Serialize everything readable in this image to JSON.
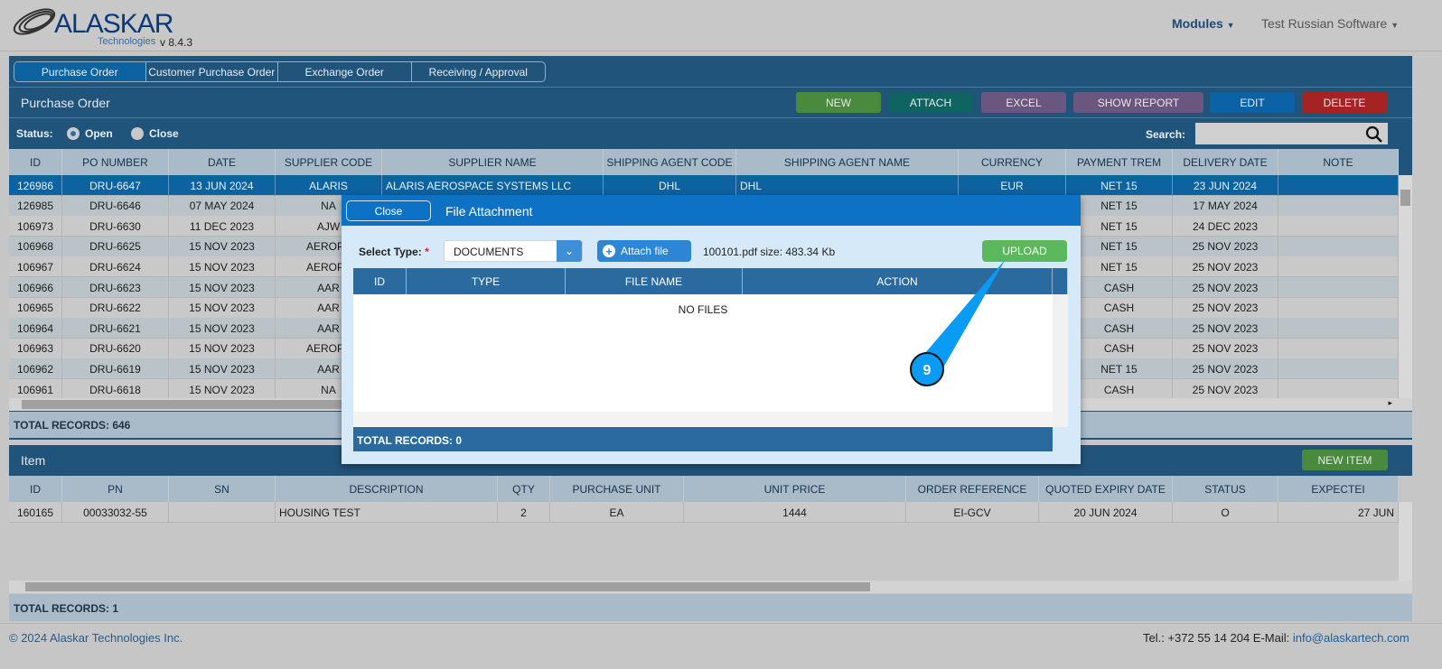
{
  "header": {
    "logo": "ALASKAR",
    "logo_sub": "Technologies",
    "version": "v 8.4.3",
    "modules": "Modules",
    "company": "Test Russian Software"
  },
  "tabs": [
    "Purchase Order",
    "Customer Purchase Order",
    "Exchange Order",
    "Receiving / Approval"
  ],
  "po": {
    "title": "Purchase Order",
    "buttons": [
      {
        "label": "NEW",
        "color": "#4a8a3f"
      },
      {
        "label": "ATTACH",
        "color": "#0f6461"
      },
      {
        "label": "EXCEL",
        "color": "#6a567e"
      },
      {
        "label": "SHOW REPORT",
        "color": "#6a567e"
      },
      {
        "label": "EDIT",
        "color": "#0b62a5"
      },
      {
        "label": "DELETE",
        "color": "#a52323"
      }
    ],
    "status_label": "Status:",
    "status_open": "Open",
    "status_close": "Close",
    "search_label": "Search:",
    "search_value": "",
    "columns": [
      "ID",
      "PO NUMBER",
      "DATE",
      "SUPPLIER CODE",
      "SUPPLIER NAME",
      "SHIPPING AGENT CODE",
      "SHIPPING AGENT NAME",
      "CURRENCY",
      "PAYMENT TREM",
      "DELIVERY DATE",
      "NOTE"
    ],
    "rows": [
      [
        "126986",
        "DRU-6647",
        "13 JUN 2024",
        "ALARIS",
        "ALARIS AEROSPACE SYSTEMS LLC",
        "DHL",
        "DHL",
        "EUR",
        "NET 15",
        "23 JUN 2024",
        ""
      ],
      [
        "126985",
        "DRU-6646",
        "07 MAY 2024",
        "NA",
        "",
        "",
        "",
        "",
        "NET 15",
        "17 MAY 2024",
        ""
      ],
      [
        "106973",
        "DRU-6630",
        "11 DEC 2023",
        "AJW",
        "",
        "",
        "",
        "",
        "NET 15",
        "24 DEC 2023",
        ""
      ],
      [
        "106968",
        "DRU-6625",
        "15 NOV 2023",
        "AEROPA",
        "",
        "",
        "",
        "",
        "NET 15",
        "25 NOV 2023",
        ""
      ],
      [
        "106967",
        "DRU-6624",
        "15 NOV 2023",
        "AEROPA",
        "",
        "",
        "",
        "",
        "NET 15",
        "25 NOV 2023",
        ""
      ],
      [
        "106966",
        "DRU-6623",
        "15 NOV 2023",
        "AAR",
        "",
        "",
        "",
        "",
        "CASH",
        "25 NOV 2023",
        ""
      ],
      [
        "106965",
        "DRU-6622",
        "15 NOV 2023",
        "AAR",
        "",
        "",
        "",
        "",
        "CASH",
        "25 NOV 2023",
        ""
      ],
      [
        "106964",
        "DRU-6621",
        "15 NOV 2023",
        "AAR",
        "",
        "",
        "",
        "",
        "CASH",
        "25 NOV 2023",
        ""
      ],
      [
        "106963",
        "DRU-6620",
        "15 NOV 2023",
        "AEROPA",
        "",
        "",
        "",
        "",
        "CASH",
        "25 NOV 2023",
        ""
      ],
      [
        "106962",
        "DRU-6619",
        "15 NOV 2023",
        "AAR",
        "",
        "",
        "",
        "",
        "NET 15",
        "25 NOV 2023",
        ""
      ],
      [
        "106961",
        "DRU-6618",
        "15 NOV 2023",
        "NA",
        "",
        "",
        "",
        "",
        "CASH",
        "25 NOV 2023",
        ""
      ]
    ],
    "total": "TOTAL RECORDS: 646"
  },
  "item": {
    "title": "Item",
    "new_item": "NEW ITEM",
    "columns": [
      "ID",
      "PN",
      "SN",
      "DESCRIPTION",
      "QTY",
      "PURCHASE UNIT",
      "UNIT PRICE",
      "ORDER REFERENCE",
      "QUOTED EXPIRY DATE",
      "STATUS",
      "EXPECTEI"
    ],
    "rows": [
      [
        "160165",
        "00033032-55",
        "",
        "HOUSING TEST",
        "2",
        "EA",
        "1444",
        "EI-GCV",
        "20 JUN 2024",
        "O",
        "27 JUN"
      ]
    ],
    "total": "TOTAL RECORDS: 1"
  },
  "modal": {
    "close": "Close",
    "title": "File Attachment",
    "select_label": "Select Type:",
    "required": "*",
    "select_value": "DOCUMENTS",
    "attach": "Attach file",
    "file_info": "100101.pdf size: 483.34 Kb",
    "upload": "UPLOAD",
    "columns": [
      "ID",
      "TYPE",
      "FILE NAME",
      "ACTION"
    ],
    "empty": "NO FILES",
    "total": "TOTAL RECORDS: 0"
  },
  "callout": {
    "step": "9",
    "color": "#0a9bf5"
  },
  "footer": {
    "copyright": "© 2024 Alaskar Technologies Inc.",
    "contact": "Tel.: +372 55 14 204 E-Mail: ",
    "email": "info@alaskartech.com"
  }
}
